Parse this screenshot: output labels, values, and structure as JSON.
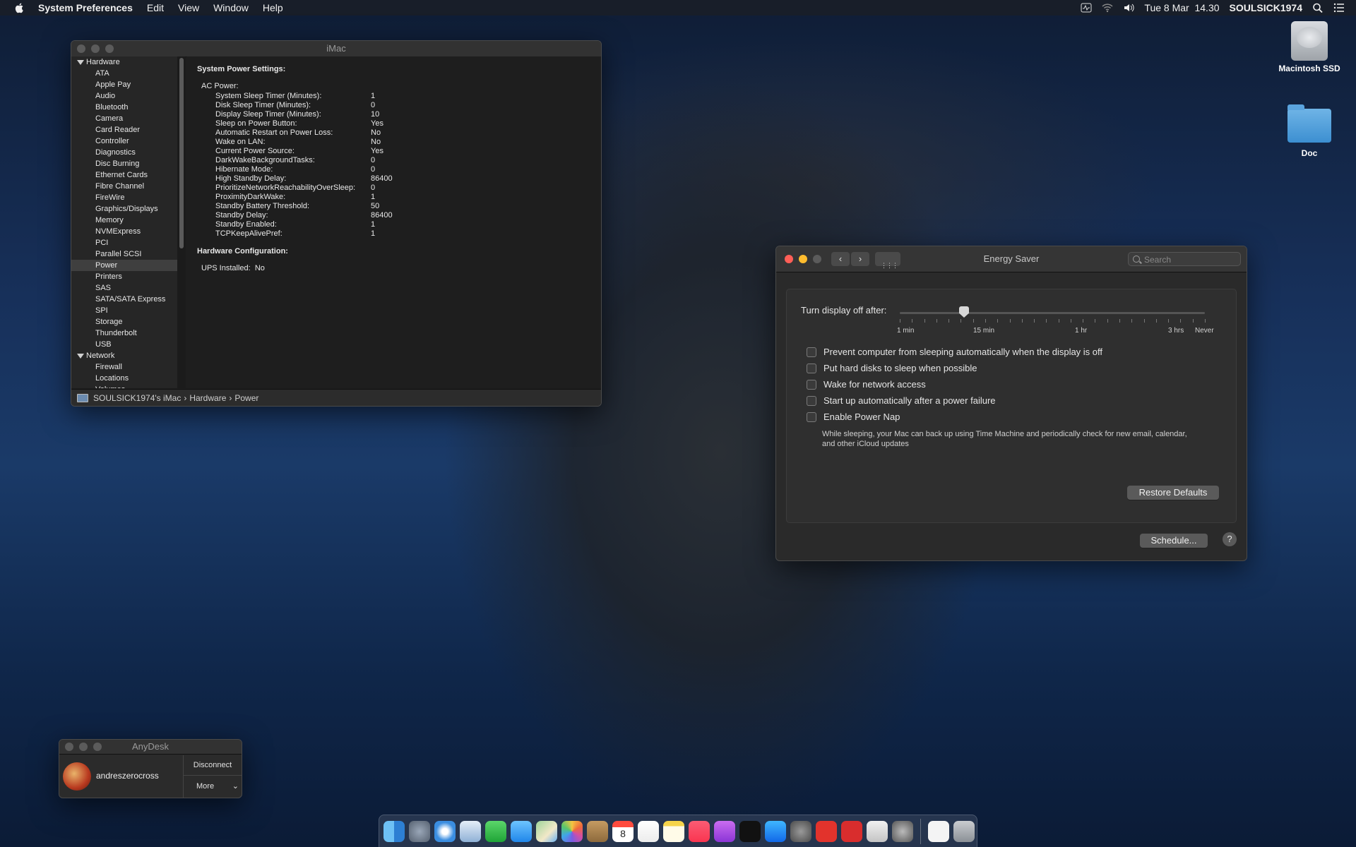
{
  "menubar": {
    "app_name": "System Preferences",
    "menus": [
      "Edit",
      "View",
      "Window",
      "Help"
    ],
    "clock": "Tue 8 Mar  14.30",
    "user": "SOULSICK1974"
  },
  "desktop": {
    "icons": [
      {
        "label": "Macintosh SSD"
      },
      {
        "label": "Doc"
      }
    ]
  },
  "sysinfo": {
    "title": "iMac",
    "sidebar": {
      "group_hardware": "Hardware",
      "hardware_items": [
        "ATA",
        "Apple Pay",
        "Audio",
        "Bluetooth",
        "Camera",
        "Card Reader",
        "Controller",
        "Diagnostics",
        "Disc Burning",
        "Ethernet Cards",
        "Fibre Channel",
        "FireWire",
        "Graphics/Displays",
        "Memory",
        "NVMExpress",
        "PCI",
        "Parallel SCSI",
        "Power",
        "Printers",
        "SAS",
        "SATA/SATA Express",
        "SPI",
        "Storage",
        "Thunderbolt",
        "USB"
      ],
      "selected": "Power",
      "group_network": "Network",
      "network_items": [
        "Firewall",
        "Locations",
        "Volumes"
      ]
    },
    "detail": {
      "heading1": "System Power Settings:",
      "section_ac": "AC Power:",
      "ac_rows": [
        {
          "k": "System Sleep Timer (Minutes):",
          "v": "1"
        },
        {
          "k": "Disk Sleep Timer (Minutes):",
          "v": "0"
        },
        {
          "k": "Display Sleep Timer (Minutes):",
          "v": "10"
        },
        {
          "k": "Sleep on Power Button:",
          "v": "Yes"
        },
        {
          "k": "Automatic Restart on Power Loss:",
          "v": "No"
        },
        {
          "k": "Wake on LAN:",
          "v": "No"
        },
        {
          "k": "Current Power Source:",
          "v": "Yes"
        },
        {
          "k": "DarkWakeBackgroundTasks:",
          "v": "0"
        },
        {
          "k": "Hibernate Mode:",
          "v": "0"
        },
        {
          "k": "High Standby Delay:",
          "v": "86400"
        },
        {
          "k": "PrioritizeNetworkReachabilityOverSleep:",
          "v": "0"
        },
        {
          "k": "ProximityDarkWake:",
          "v": "1"
        },
        {
          "k": "Standby Battery Threshold:",
          "v": "50"
        },
        {
          "k": "Standby Delay:",
          "v": "86400"
        },
        {
          "k": "Standby Enabled:",
          "v": "1"
        },
        {
          "k": "TCPKeepAlivePref:",
          "v": "1"
        }
      ],
      "heading2": "Hardware Configuration:",
      "ups_label": "UPS Installed:",
      "ups_value": "No"
    },
    "statusbar": {
      "computer": "SOULSICK1974's iMac",
      "sep": "›",
      "level1": "Hardware",
      "level2": "Power"
    }
  },
  "energy": {
    "title": "Energy Saver",
    "search_placeholder": "Search",
    "slider_label": "Turn display off after:",
    "tick_labels": [
      "1 min",
      "15 min",
      "1 hr",
      "3 hrs",
      "Never"
    ],
    "slider_value": "10",
    "options": [
      {
        "label": "Prevent computer from sleeping automatically when the display is off",
        "checked": false
      },
      {
        "label": "Put hard disks to sleep when possible",
        "checked": false
      },
      {
        "label": "Wake for network access",
        "checked": false
      },
      {
        "label": "Start up automatically after a power failure",
        "checked": false
      },
      {
        "label": "Enable Power Nap",
        "checked": false
      }
    ],
    "power_nap_desc": "While sleeping, your Mac can back up using Time Machine and periodically check for new email, calendar, and other iCloud updates",
    "restore_defaults": "Restore Defaults",
    "schedule": "Schedule...",
    "help": "?"
  },
  "anydesk": {
    "title": "AnyDesk",
    "user": "andreszerocross",
    "disconnect": "Disconnect",
    "more": "More"
  },
  "dock": {
    "items": [
      "finder-icon",
      "launchpad-icon",
      "safari-icon",
      "mail-icon",
      "facetime-icon",
      "messages-icon",
      "maps-icon",
      "photos-icon",
      "contacts-icon",
      "calendar-icon",
      "reminders-icon",
      "notes-icon",
      "music-icon",
      "podcasts-icon",
      "tv-icon",
      "app-store-icon",
      "system-preferences-icon",
      "anydesk-icon",
      "anydesk-alt-icon",
      "script-editor-icon",
      "automator-icon",
      "document-icon",
      "trash-icon"
    ],
    "calendar_day": "8"
  }
}
